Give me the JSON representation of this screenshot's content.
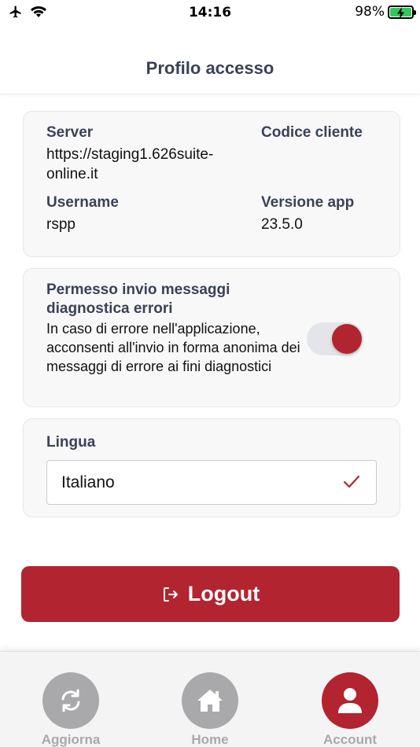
{
  "status_bar": {
    "time": "14:16",
    "battery_percent": "98%",
    "icons": [
      "airplane-icon",
      "wifi-icon",
      "battery-charging-icon"
    ]
  },
  "header": {
    "title": "Profilo accesso"
  },
  "info": {
    "server_label": "Server",
    "server_value_line1": "https://staging1.626suite-",
    "server_value_line2": "online.it",
    "client_code_label": "Codice cliente",
    "client_code_value": "",
    "username_label": "Username",
    "username_value": "rspp",
    "version_label": "Versione app",
    "version_value": "23.5.0"
  },
  "diagnostics": {
    "title": "Permesso invio messaggi diagnostica errori",
    "description": "In caso di errore nell'applicazione, acconsenti all'invio in forma anonima dei messaggi di errore ai fini diagnostici",
    "enabled": true
  },
  "language": {
    "label": "Lingua",
    "selected": "Italiano"
  },
  "logout": {
    "label": "Logout",
    "icon": "logout-icon"
  },
  "bottom_nav": {
    "items": [
      {
        "label": "Aggiorna",
        "icon": "refresh-icon",
        "active": false
      },
      {
        "label": "Home",
        "icon": "home-icon",
        "active": false
      },
      {
        "label": "Account",
        "icon": "user-icon",
        "active": true
      }
    ]
  },
  "colors": {
    "accent": "#b22430",
    "inactive": "#a9a9ab",
    "label": "#3a4255",
    "card_bg": "#f8f8f9"
  }
}
